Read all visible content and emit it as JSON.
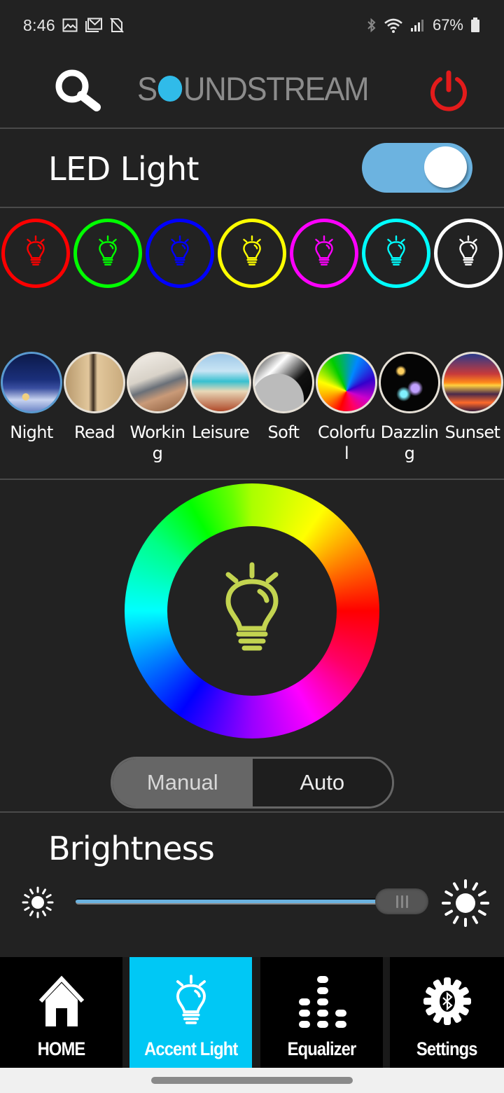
{
  "status_bar": {
    "time": "8:46",
    "left_icons": [
      "gallery-icon",
      "gmail-icon",
      "no-sim-icon"
    ],
    "right_icons": [
      "bluetooth-icon",
      "wifi-icon",
      "signal-icon",
      "battery-icon"
    ],
    "battery_percent": "67%"
  },
  "header": {
    "brand_prefix": "S",
    "brand_suffix": "UNDSTREAM",
    "brand_dot_color": "#30bbe9",
    "search_icon": "search-icon",
    "power_icon": "power-icon",
    "power_color": "#e31b1b"
  },
  "led": {
    "title": "LED Light",
    "toggle_on": true,
    "toggle_color": "#6cb3e0"
  },
  "swatches": [
    {
      "name": "red",
      "color": "#ff0000"
    },
    {
      "name": "green",
      "color": "#00ff00"
    },
    {
      "name": "blue",
      "color": "#0000ff"
    },
    {
      "name": "yellow",
      "color": "#ffff00"
    },
    {
      "name": "magenta",
      "color": "#ff00ff"
    },
    {
      "name": "cyan",
      "color": "#00ffff"
    },
    {
      "name": "white",
      "color": "#ffffff"
    }
  ],
  "scenes": [
    {
      "label": "Night",
      "selected": true
    },
    {
      "label": "Read",
      "selected": false
    },
    {
      "label": "Working",
      "selected": false
    },
    {
      "label": "Leisure",
      "selected": false
    },
    {
      "label": "Soft",
      "selected": false
    },
    {
      "label": "Colorful",
      "selected": false
    },
    {
      "label": "Dazzling",
      "selected": false
    },
    {
      "label": "Sunset",
      "selected": false
    }
  ],
  "color_wheel": {
    "center_icon": "light-bulb-icon",
    "current_color": "#c3d450"
  },
  "mode": {
    "options": [
      "Manual",
      "Auto"
    ],
    "selected": "Manual"
  },
  "brightness": {
    "title": "Brightness",
    "value_percent": 100,
    "min_icon": "sun-small-icon",
    "max_icon": "sun-large-icon"
  },
  "bottom_nav": {
    "items": [
      {
        "label": "HOME",
        "icon": "home-icon",
        "active": false
      },
      {
        "label": "Accent Light",
        "icon": "light-bulb-icon",
        "active": true
      },
      {
        "label": "Equalizer",
        "icon": "equalizer-icon",
        "active": false
      },
      {
        "label": "Settings",
        "icon": "bluetooth-gear-icon",
        "active": false
      }
    ],
    "active_color": "#00c8f5"
  }
}
